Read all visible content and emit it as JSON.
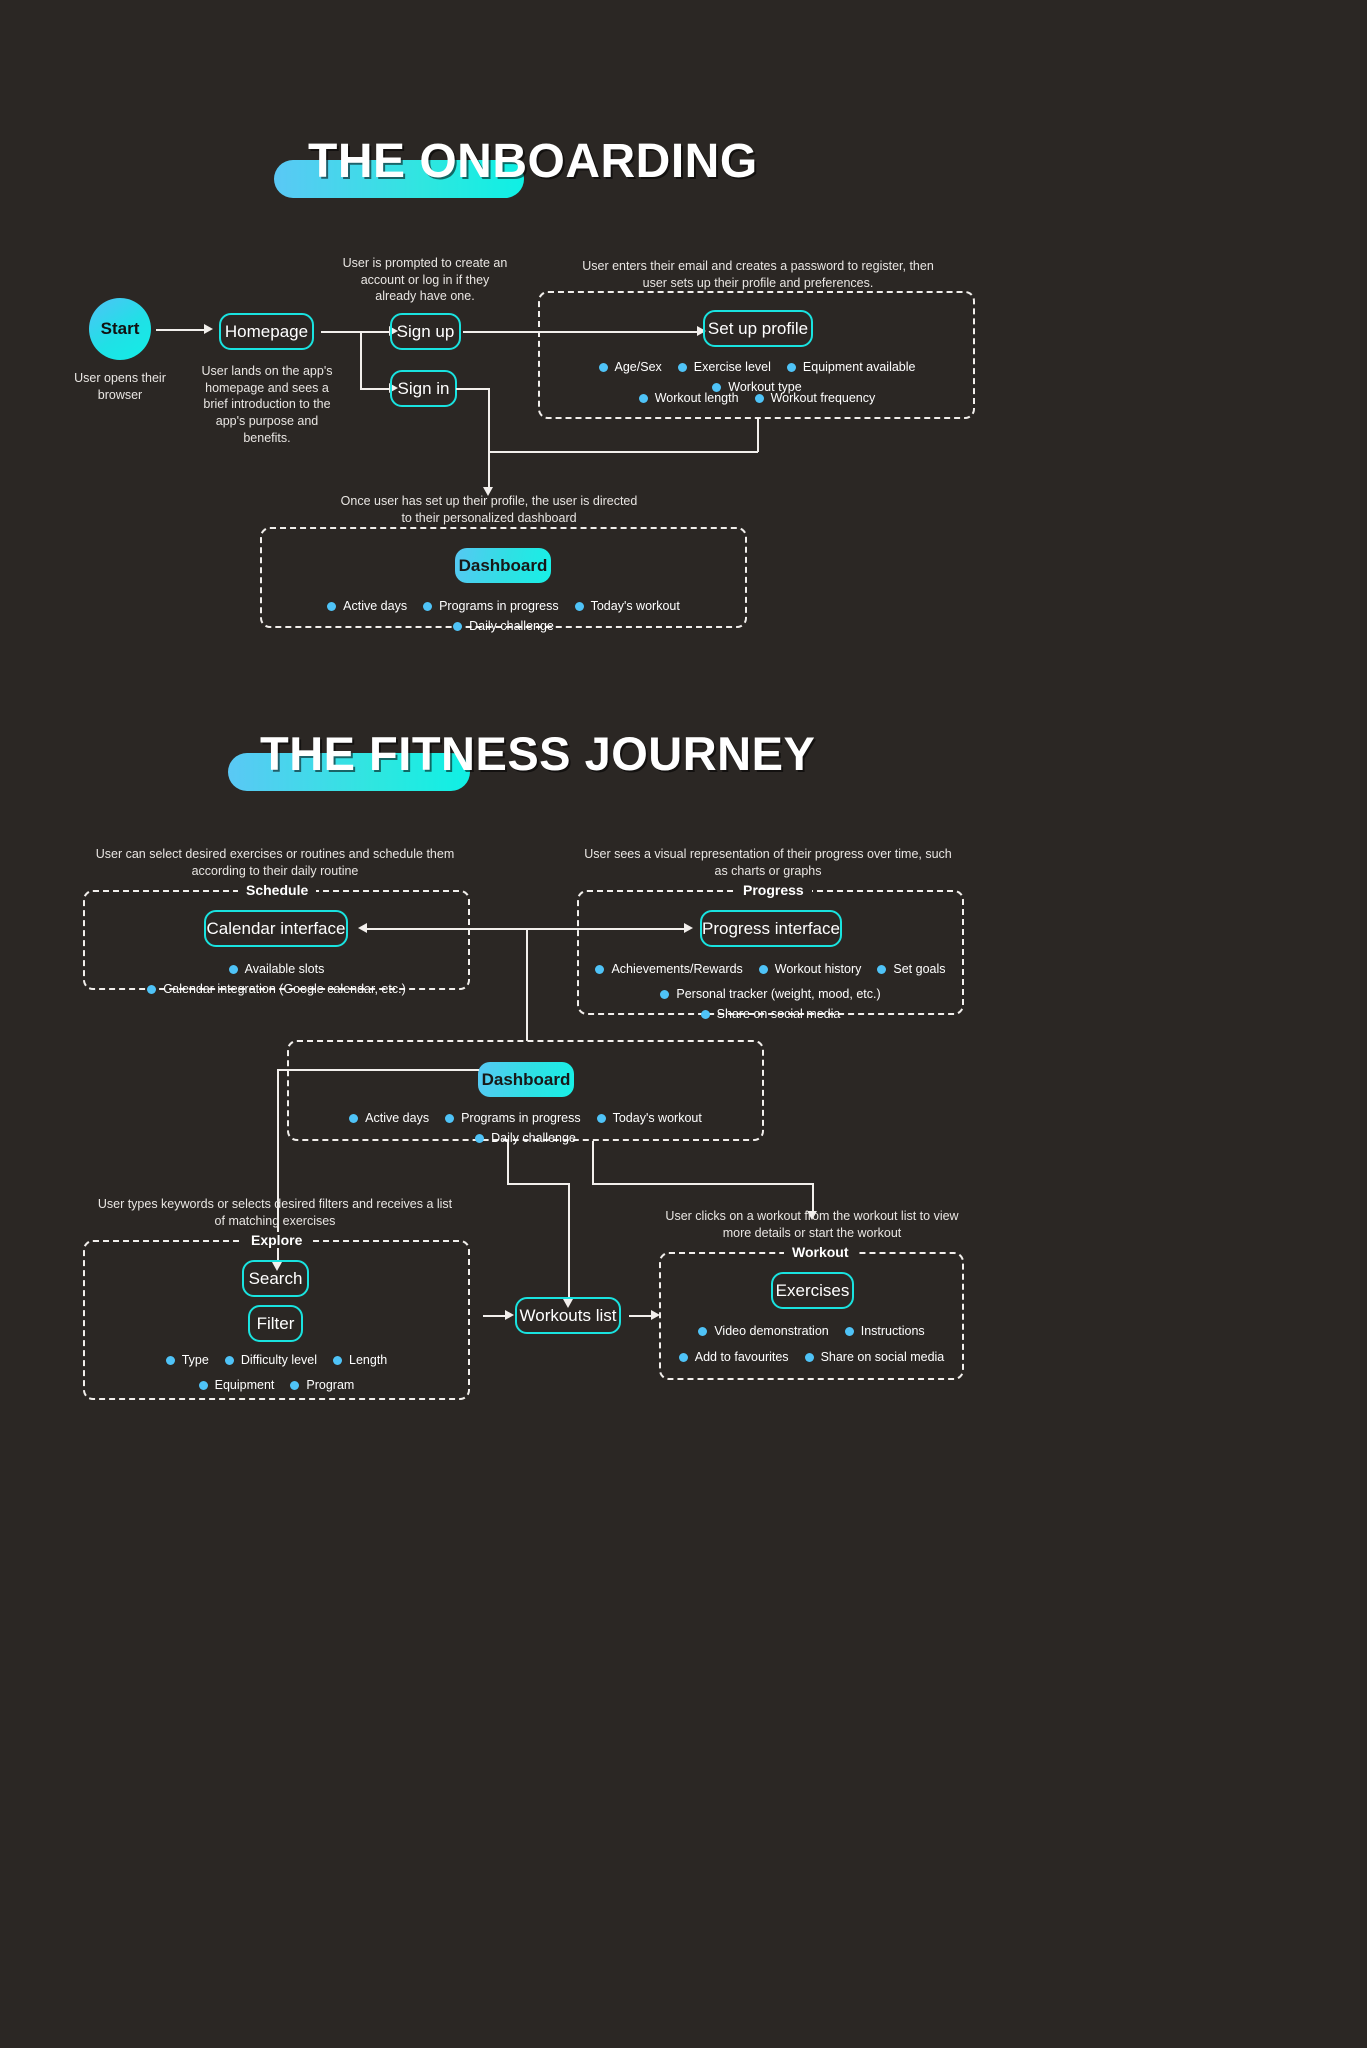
{
  "theme": {
    "background": "#2b2724",
    "accent_cyan": "#19e3e0",
    "accent_blue": "#4fc3f7",
    "text": "#ffffff"
  },
  "sections": [
    {
      "id": "onboarding",
      "title": "THE ONBOARDING"
    },
    {
      "id": "fitness_journey",
      "title": "THE FITNESS JOURNEY"
    }
  ],
  "onboarding": {
    "start_node": "Start",
    "start_caption": "User opens their browser",
    "homepage_node": "Homepage",
    "homepage_caption": "User lands on the app's homepage and sees a brief introduction to the app's purpose and benefits.",
    "signup_node": "Sign up",
    "signin_node": "Sign in",
    "signup_caption": "User is prompted to create an account or log in if they already have one.",
    "profile_caption": "User enters their email and creates a password to register, then user sets up their profile and preferences.",
    "profile_node": "Set up profile",
    "profile_bullets_row1": [
      "Age/Sex",
      "Exercise level",
      "Equipment available",
      "Workout type"
    ],
    "profile_bullets_row2": [
      "Workout length",
      "Workout frequency"
    ],
    "dashboard_caption": "Once user has set up their profile, the user is directed to their personalized dashboard",
    "dashboard_node": "Dashboard",
    "dashboard_bullets": [
      "Active days",
      "Programs in progress",
      "Today's workout",
      "Daily challenge"
    ]
  },
  "journey": {
    "schedule_caption": "User can select desired exercises or routines and schedule them according to their daily routine",
    "schedule_group_label": "Schedule",
    "schedule_node": "Calendar interface",
    "schedule_bullets": [
      "Available slots",
      "Calendar integration (Google calendar, etc.)"
    ],
    "progress_caption": "User sees a visual representation of their progress over time, such as charts or graphs",
    "progress_group_label": "Progress",
    "progress_node": "Progress interface",
    "progress_bullets_row1": [
      "Achievements/Rewards",
      "Workout history",
      "Set goals"
    ],
    "progress_bullets_row2": [
      "Personal tracker (weight, mood, etc.)",
      "Share on social media"
    ],
    "dashboard_node": "Dashboard",
    "dashboard_bullets": [
      "Active days",
      "Programs in progress",
      "Today's workout",
      "Daily challenge"
    ],
    "explore_caption": "User types keywords or selects desired filters and receives a list of matching exercises",
    "explore_group_label": "Explore",
    "explore_search_node": "Search",
    "explore_filter_node": "Filter",
    "explore_bullets_row1": [
      "Type",
      "Difficulty level",
      "Length"
    ],
    "explore_bullets_row2": [
      "Equipment",
      "Program"
    ],
    "workouts_list_node": "Workouts list",
    "workout_caption": "User clicks on a workout from the workout list to view more details or start the workout",
    "workout_group_label": "Workout",
    "workout_node": "Exercises",
    "workout_bullets_row1": [
      "Video demonstration",
      "Instructions"
    ],
    "workout_bullets_row2": [
      "Add to favourites",
      "Share on social media"
    ]
  }
}
